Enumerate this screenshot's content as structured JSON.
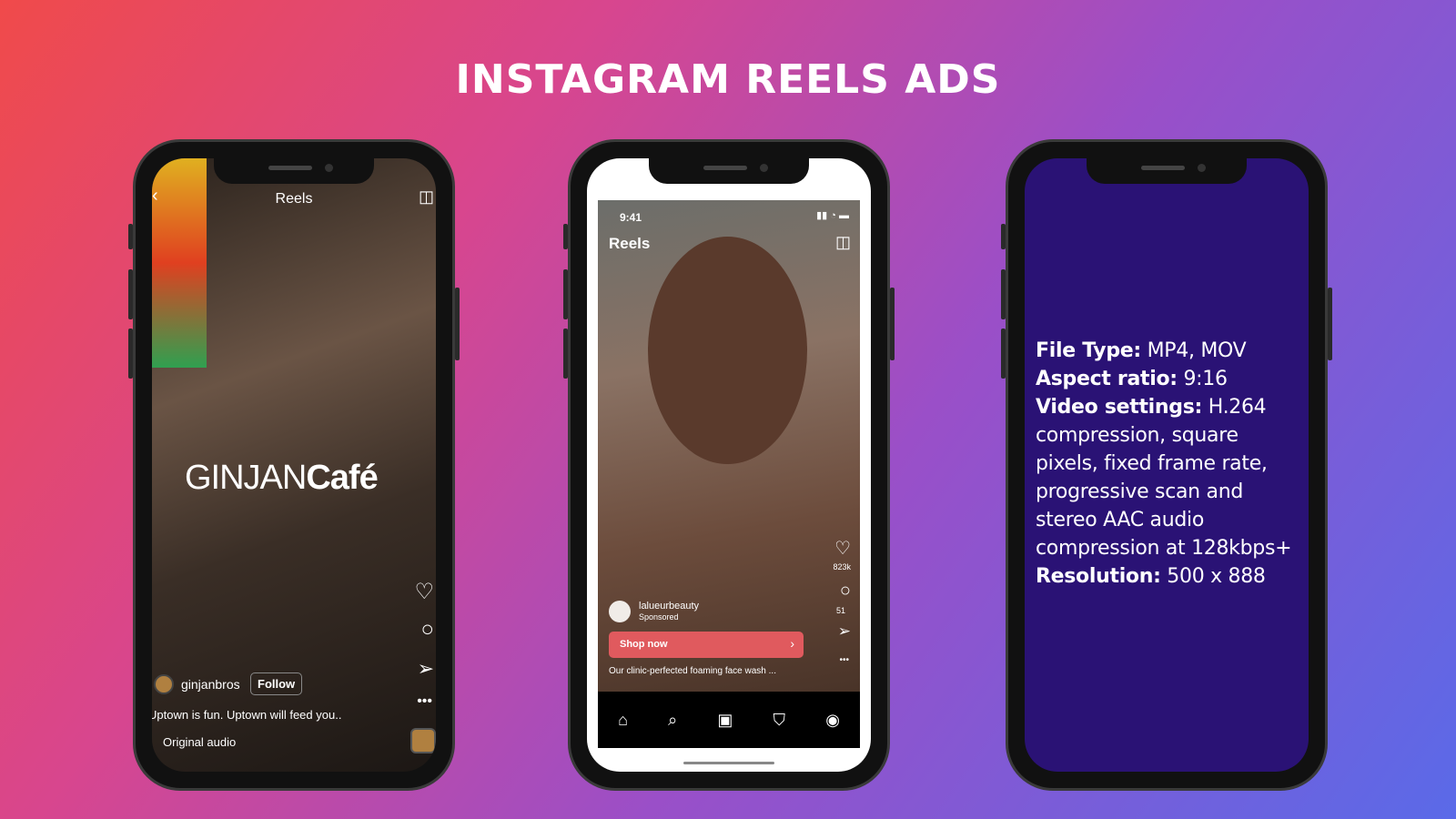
{
  "title": "INSTAGRAM REELS ADS",
  "phone1": {
    "header": "Reels",
    "brand_thin": "GINJAN",
    "brand_bold": "Café",
    "username": "ginjanbros",
    "follow": "Follow",
    "caption": "Uptown is fun. Uptown will feed you..",
    "audio": "Original audio"
  },
  "phone2": {
    "time": "9:41",
    "header": "Reels",
    "likes": "823k",
    "comments": "51",
    "username": "lalueurbeauty",
    "sponsored": "Sponsored",
    "cta": "Shop now",
    "caption": "Our clinic-perfected foaming face wash ...",
    "nav": [
      "home-icon",
      "search-icon",
      "reels-icon",
      "shop-icon",
      "profile-icon"
    ],
    "cta_color": "#e05a5e"
  },
  "phone3": {
    "specs": [
      {
        "label": "File Type:",
        "value": " MP4, MOV"
      },
      {
        "label": "Aspect ratio:",
        "value": " 9:16"
      },
      {
        "label": "Video settings:",
        "value": " H.264 compression, square pixels, fixed frame rate, progressive scan and stereo AAC audio compression at 128kbps+"
      },
      {
        "label": "Resolution:",
        "value": " 500 x 888"
      }
    ]
  }
}
